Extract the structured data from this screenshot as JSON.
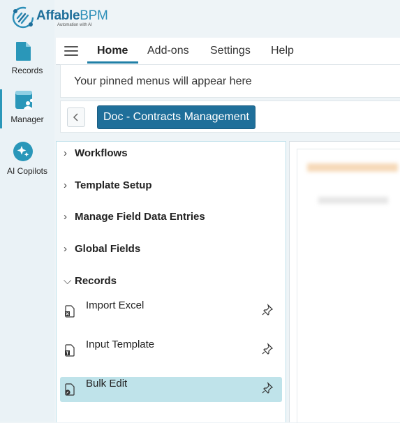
{
  "brand": {
    "name_bold": "Affable",
    "name_light": "BPM",
    "tagline": "Automation with AI"
  },
  "rail": {
    "items": [
      {
        "label": "Records",
        "icon": "records-icon"
      },
      {
        "label": "Manager",
        "icon": "manager-icon"
      },
      {
        "label": "AI Copilots",
        "icon": "ai-copilots-icon"
      }
    ]
  },
  "tabs": [
    {
      "label": "Home"
    },
    {
      "label": "Add-ons"
    },
    {
      "label": "Settings"
    },
    {
      "label": "Help"
    }
  ],
  "pinned": {
    "text": "Your pinned menus will appear here"
  },
  "breadcrumb": {
    "current": "Doc - Contracts Management"
  },
  "menu": {
    "sections": [
      {
        "label": "Workflows"
      },
      {
        "label": "Template Setup"
      },
      {
        "label": "Manage Field Data Entries"
      },
      {
        "label": "Global Fields"
      },
      {
        "label": "Records"
      }
    ],
    "record_items": [
      {
        "label": "Import Excel"
      },
      {
        "label": "Input Template"
      },
      {
        "label": "Bulk Edit"
      }
    ]
  },
  "colors": {
    "accent": "#1f6f9a",
    "selected_row": "#bfe3ea",
    "rail_active": "#2a97b9"
  }
}
